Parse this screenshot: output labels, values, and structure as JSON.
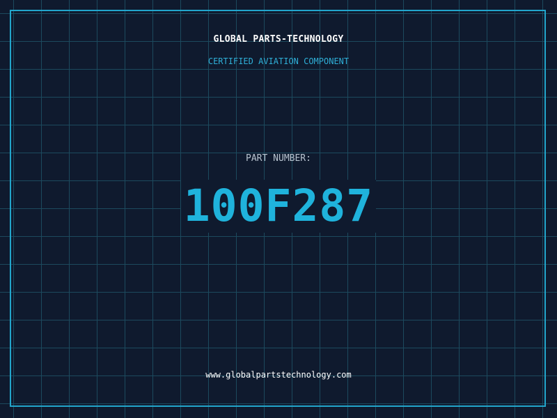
{
  "header": {
    "company": "GLOBAL PARTS-TECHNOLOGY",
    "subtitle": "CERTIFIED AVIATION COMPONENT"
  },
  "part": {
    "label": "PART NUMBER:",
    "number": "100F287"
  },
  "footer": {
    "url": "www.globalpartstechnology.com"
  },
  "colors": {
    "background": "#0f1a2e",
    "grid": "#1c4a5e",
    "accent": "#1fb3dc",
    "frame": "#22a6cc"
  }
}
